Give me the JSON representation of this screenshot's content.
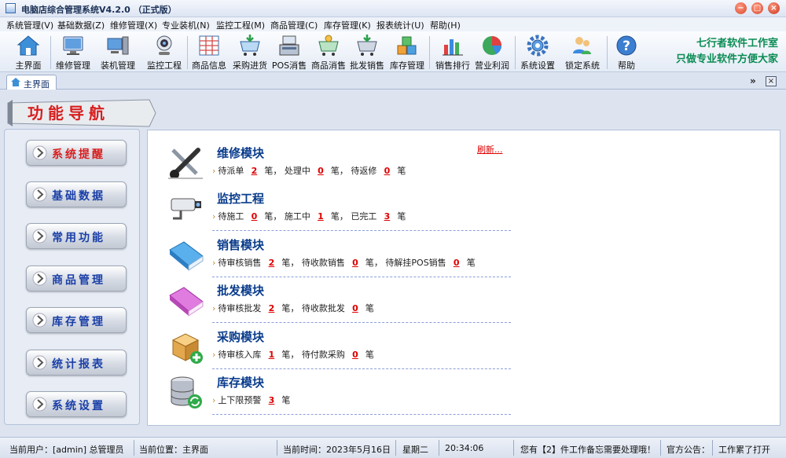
{
  "window": {
    "title": "电脑店综合管理系统V4.2.0 （正式版）"
  },
  "menu": [
    "系统管理(V)",
    "基础数据(Z)",
    "维修管理(X)",
    "专业装机(N)",
    "监控工程(M)",
    "商品管理(C)",
    "库存管理(K)",
    "报表统计(U)",
    "帮助(H)"
  ],
  "toolbar": {
    "items": [
      {
        "label": "主界面",
        "icon": "home-icon"
      },
      {
        "label": "维修管理",
        "icon": "monitor-icon"
      },
      {
        "label": "装机管理",
        "icon": "computer-icon"
      },
      {
        "label": "监控工程",
        "icon": "webcam-icon"
      },
      {
        "label": "商品信息",
        "icon": "grid-icon"
      },
      {
        "label": "采购进货",
        "icon": "cart-in-icon"
      },
      {
        "label": "POS消售",
        "icon": "pos-icon"
      },
      {
        "label": "商品消售",
        "icon": "cart-icon"
      },
      {
        "label": "批发销售",
        "icon": "cart-wholesale-icon"
      },
      {
        "label": "库存管理",
        "icon": "boxes-icon"
      },
      {
        "label": "销售排行",
        "icon": "bar-chart-icon"
      },
      {
        "label": "营业利润",
        "icon": "pie-chart-icon"
      },
      {
        "label": "系统设置",
        "icon": "gear-icon"
      },
      {
        "label": "锁定系统",
        "icon": "users-lock-icon"
      },
      {
        "label": "帮助",
        "icon": "help-icon"
      }
    ],
    "brand_line1": "七行者软件工作室",
    "brand_line2": "只做专业软件方便大家"
  },
  "tabs": [
    {
      "label": "主界面"
    }
  ],
  "nav": {
    "banner": "功能导航",
    "buttons": [
      {
        "label": "系统提醒",
        "color": "#d81e1e"
      },
      {
        "label": "基础数据",
        "color": "#1a3fa8"
      },
      {
        "label": "常用功能",
        "color": "#1a3fa8"
      },
      {
        "label": "商品管理",
        "color": "#1a3fa8"
      },
      {
        "label": "库存管理",
        "color": "#1a3fa8"
      },
      {
        "label": "统计报表",
        "color": "#1a3fa8"
      },
      {
        "label": "系统设置",
        "color": "#1a3fa8"
      }
    ]
  },
  "content": {
    "refresh_label": "刷新...",
    "modules": [
      {
        "title": "维修模块",
        "icon": "tools-icon",
        "stats": [
          {
            "label": "待派单",
            "value": "2",
            "unit": "笔，"
          },
          {
            "label": "处理中",
            "value": "0",
            "unit": "笔，"
          },
          {
            "label": "待返修",
            "value": "0",
            "unit": "笔"
          }
        ]
      },
      {
        "title": "监控工程",
        "icon": "cctv-camera-icon",
        "stats": [
          {
            "label": "待施工",
            "value": "0",
            "unit": "笔，"
          },
          {
            "label": "施工中",
            "value": "1",
            "unit": "笔，"
          },
          {
            "label": "已完工",
            "value": "3",
            "unit": "笔"
          }
        ]
      },
      {
        "title": "销售模块",
        "icon": "blue-book-icon",
        "stats": [
          {
            "label": "待审核销售",
            "value": "2",
            "unit": "笔，"
          },
          {
            "label": "待收款销售",
            "value": "0",
            "unit": "笔，"
          },
          {
            "label": "待解挂POS销售",
            "value": "0",
            "unit": "笔"
          }
        ]
      },
      {
        "title": "批发模块",
        "icon": "pink-book-icon",
        "stats": [
          {
            "label": "待审核批发",
            "value": "2",
            "unit": "笔，"
          },
          {
            "label": "待收款批发",
            "value": "0",
            "unit": "笔"
          }
        ]
      },
      {
        "title": "采购模块",
        "icon": "box-add-icon",
        "stats": [
          {
            "label": "待审核入库",
            "value": "1",
            "unit": "笔，"
          },
          {
            "label": "待付款采购",
            "value": "0",
            "unit": "笔"
          }
        ]
      },
      {
        "title": "库存模块",
        "icon": "database-refresh-icon",
        "stats": [
          {
            "label": "上下限预警",
            "value": "3",
            "unit": "笔"
          }
        ]
      }
    ]
  },
  "status": {
    "user": "当前用户：[admin] 总管理员",
    "location": "当前位置：主界面",
    "time": "当前时间：2023年5月16日",
    "weekday": "星期二",
    "clock": "20:34:06",
    "notice": "您有【2】件工作备忘需要处理哦！",
    "announce": "官方公告：",
    "marquee": "工作累了打开"
  }
}
